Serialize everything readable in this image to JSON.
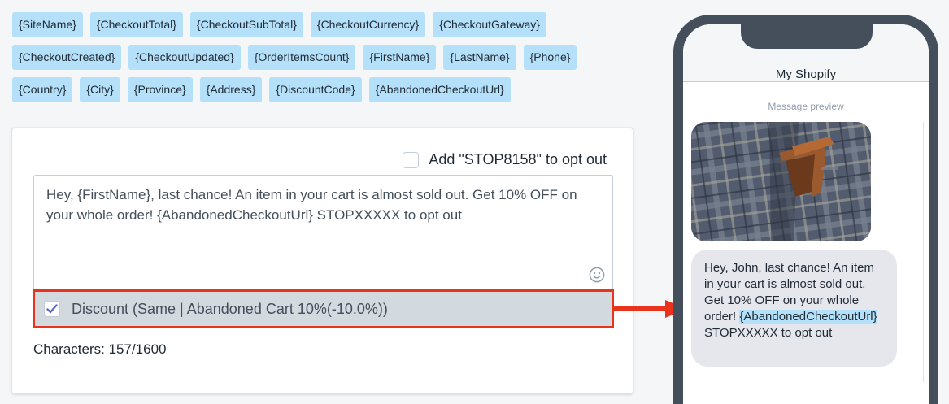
{
  "tags": [
    [
      "{SiteName}",
      "{CheckoutTotal}",
      "{CheckoutSubTotal}",
      "{CheckoutCurrency}",
      "{CheckoutGateway}"
    ],
    [
      "{CheckoutCreated}",
      "{CheckoutUpdated}",
      "{OrderItemsCount}",
      "{FirstName}",
      "{LastName}",
      "{Phone}"
    ],
    [
      "{Country}",
      "{City}",
      "{Province}",
      "{Address}",
      "{DiscountCode}",
      "{AbandonedCheckoutUrl}"
    ]
  ],
  "editor": {
    "optout_label": "Add \"STOP8158\" to opt out",
    "optout_checked": false,
    "message": "Hey, {FirstName}, last chance! An item in your cart is almost sold out. Get 10% OFF on your whole order! {AbandonedCheckoutUrl} STOPXXXXX to opt out",
    "discount_label": "Discount (Same | Abandoned Cart 10%(-10.0%))",
    "discount_checked": true,
    "characters": "Characters: 157/1600"
  },
  "phone": {
    "title": "My Shopify",
    "preview_label": "Message preview",
    "bubble_before": "Hey, John, last chance! An item in your cart is almost sold out. Get 10% OFF on your whole order! ",
    "bubble_link": "{AbandonedCheckoutUrl}",
    "bubble_after": " STOPXXXXX to opt out"
  },
  "colors": {
    "tag_bg": "#b4e0fa",
    "highlight": "#e8341c",
    "phone_frame": "#454f5b",
    "bubble_bg": "#e6e7ec"
  },
  "icons": {
    "emoji": "smiley-icon",
    "check": "checkmark-icon",
    "arrow": "arrow-right-icon"
  }
}
